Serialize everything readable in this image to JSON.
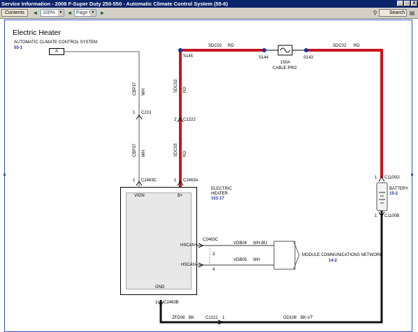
{
  "window": {
    "title": "Service Information - 2008 F-Super Duty 250-550 - Automatic Climate Control System (55-6)",
    "buttons": [
      "_",
      "□",
      "X"
    ]
  },
  "toolbar": {
    "contents_label": "Contents",
    "zoom_value": "100%",
    "page_value": "Page 6",
    "search_label": "Search"
  },
  "diagram": {
    "title": "Electric Heater",
    "source_system": "AUTOMATIC CLIMATE CONTROL SYSTEM",
    "source_ref": "55-1",
    "connector_tag": "A",
    "splice_s145": "S145",
    "splice_s144": "S144",
    "splice_s143": "S143",
    "fuse_label": "150A",
    "fuse_sub": "CABLE PRO",
    "circuit_sdc02_a": "SDC02",
    "color_rd_a": "RD",
    "circuit_sdc02_b": "SDC02",
    "color_rd_b": "RD",
    "circuit_sdc02_vert": "SDC02",
    "color_rd_vert": "RD",
    "circuit_sdc03_vert": "SDC03",
    "color_rd_vert2": "RD",
    "circuit_cbp37_a": "CBP37",
    "color_wh_a": "WH",
    "circuit_cbp37_b": "CBP37",
    "color_wh_b": "WH",
    "c213": "C213",
    "c213_pin": "1",
    "c1222_top": "C1222",
    "c1222_top_pin": "2",
    "c2463c_top": "C2463C",
    "c2463c_top_pin": "1",
    "c2463a": "C2463A",
    "c2463a_pin": "1",
    "heater_name_1": "ELECTRIC",
    "heater_name_2": "HEATER",
    "heater_ref": "151-17",
    "pin_vign": "VIGN",
    "pin_bplus": "B+",
    "pin_hscanp": "HSCAN+",
    "pin_hscanm": "HSCAN-",
    "pin_gnd": "GND",
    "c2463c_mid": "C2463C",
    "vdb04": "VDB04",
    "wh_bu": "WH-BU",
    "pin3": "3",
    "vdb05": "VDB05",
    "wh": "WH",
    "pin4": "4",
    "module_net": "MODULE COMMUNICATIONS NETWORK",
    "module_ref": "14-2",
    "c1100g": "C1100G",
    "c1100g_pin": "1",
    "battery_name": "BATTERY",
    "battery_ref": "15-2",
    "c1100b": "C1100B",
    "c1100b_pin": "1",
    "c2463b": "C2463B",
    "c2463b_pin": "1",
    "zfd08": "ZFD08",
    "bk": "BK",
    "c1222_bot": "C1222",
    "c1222_bot_pin": "1",
    "gd108": "GD108",
    "bk_vt": "BK-VT",
    "wire_red": "#c8141e",
    "wire_black": "#111111",
    "wire_gray": "#9a9a9a",
    "node_blue": "#1a2fa0"
  }
}
